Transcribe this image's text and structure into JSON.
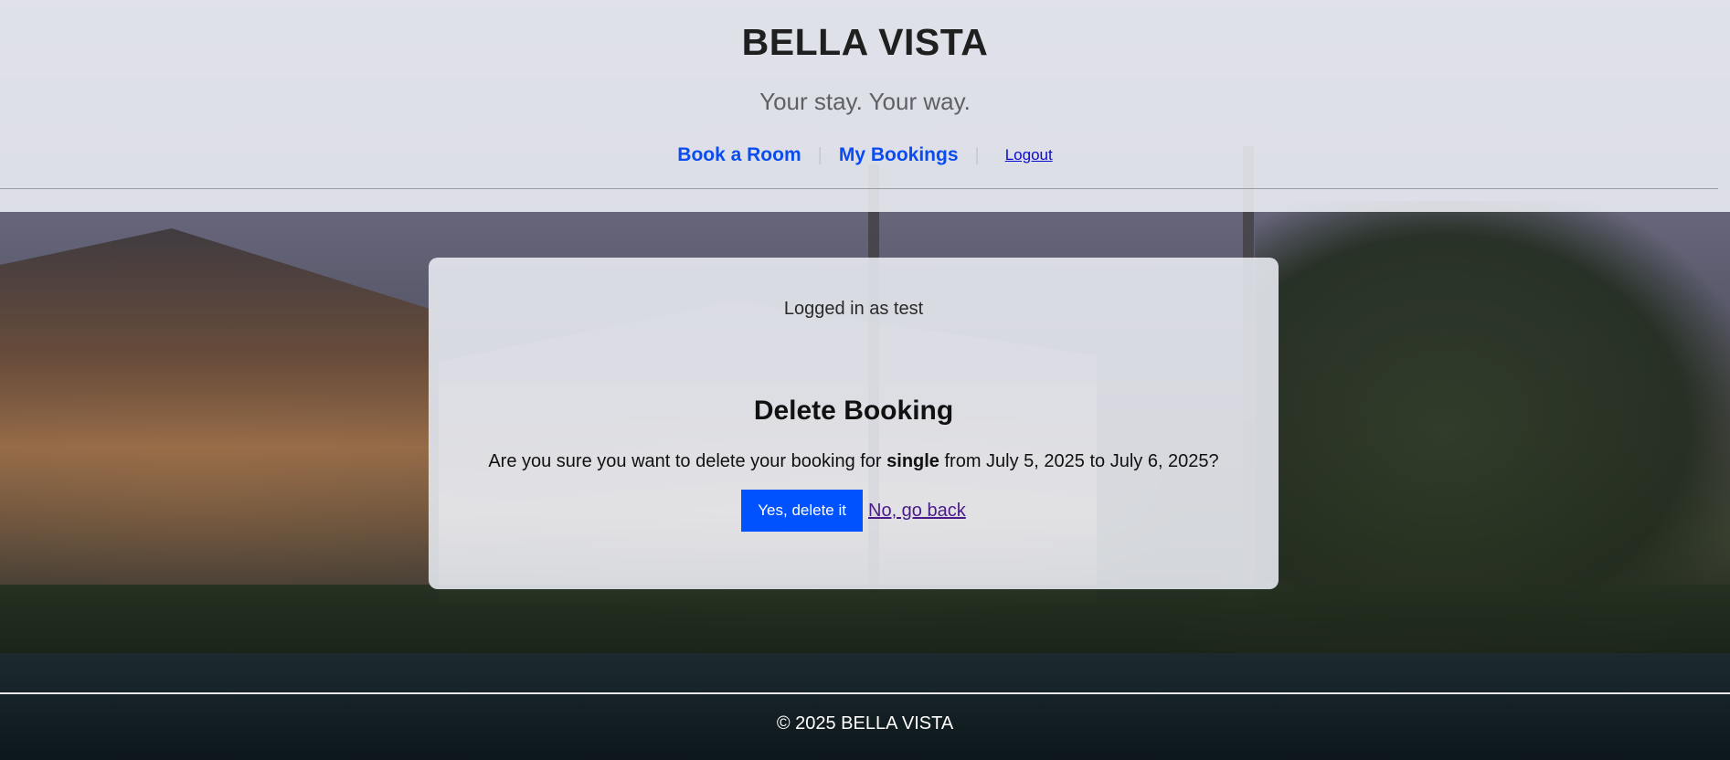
{
  "header": {
    "brand": "BELLA VISTA",
    "tagline": "Your stay. Your way.",
    "nav": {
      "book_room": "Book a Room",
      "separator": "|",
      "my_bookings": "My Bookings",
      "logout": "Logout"
    }
  },
  "card": {
    "logged_in_text": "Logged in as test",
    "title": "Delete Booking",
    "confirm_prefix": "Are you sure you want to delete your booking for ",
    "room_type": "single",
    "confirm_suffix": " from July 5, 2025 to July 6, 2025?",
    "confirm_button": "Yes, delete it",
    "back_link": "No, go back"
  },
  "footer": {
    "copyright": "© 2025 BELLA VISTA"
  },
  "colors": {
    "accent": "#0052ff",
    "nav_link": "#0a4cf0",
    "visited_link": "#4a1a8a"
  }
}
